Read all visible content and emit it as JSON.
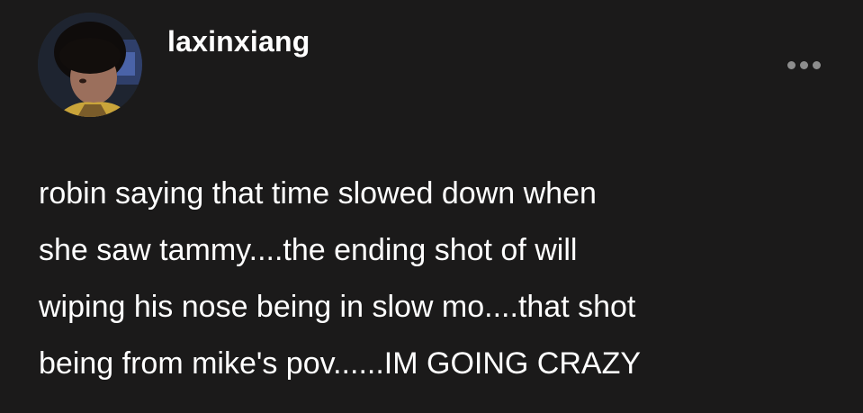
{
  "post": {
    "username": "laxinxiang",
    "avatar_icon": "user-avatar",
    "more_icon": "ellipsis-icon",
    "text_lines": [
      "robin saying that time slowed down when",
      "she saw tammy....the ending shot of will",
      "wiping his nose being in slow mo....that shot",
      "being from mike's pov......IM GOING CRAZY"
    ]
  },
  "colors": {
    "background": "#1b1a1a",
    "text": "#ffffff",
    "muted_icon": "#8d8d8d"
  }
}
